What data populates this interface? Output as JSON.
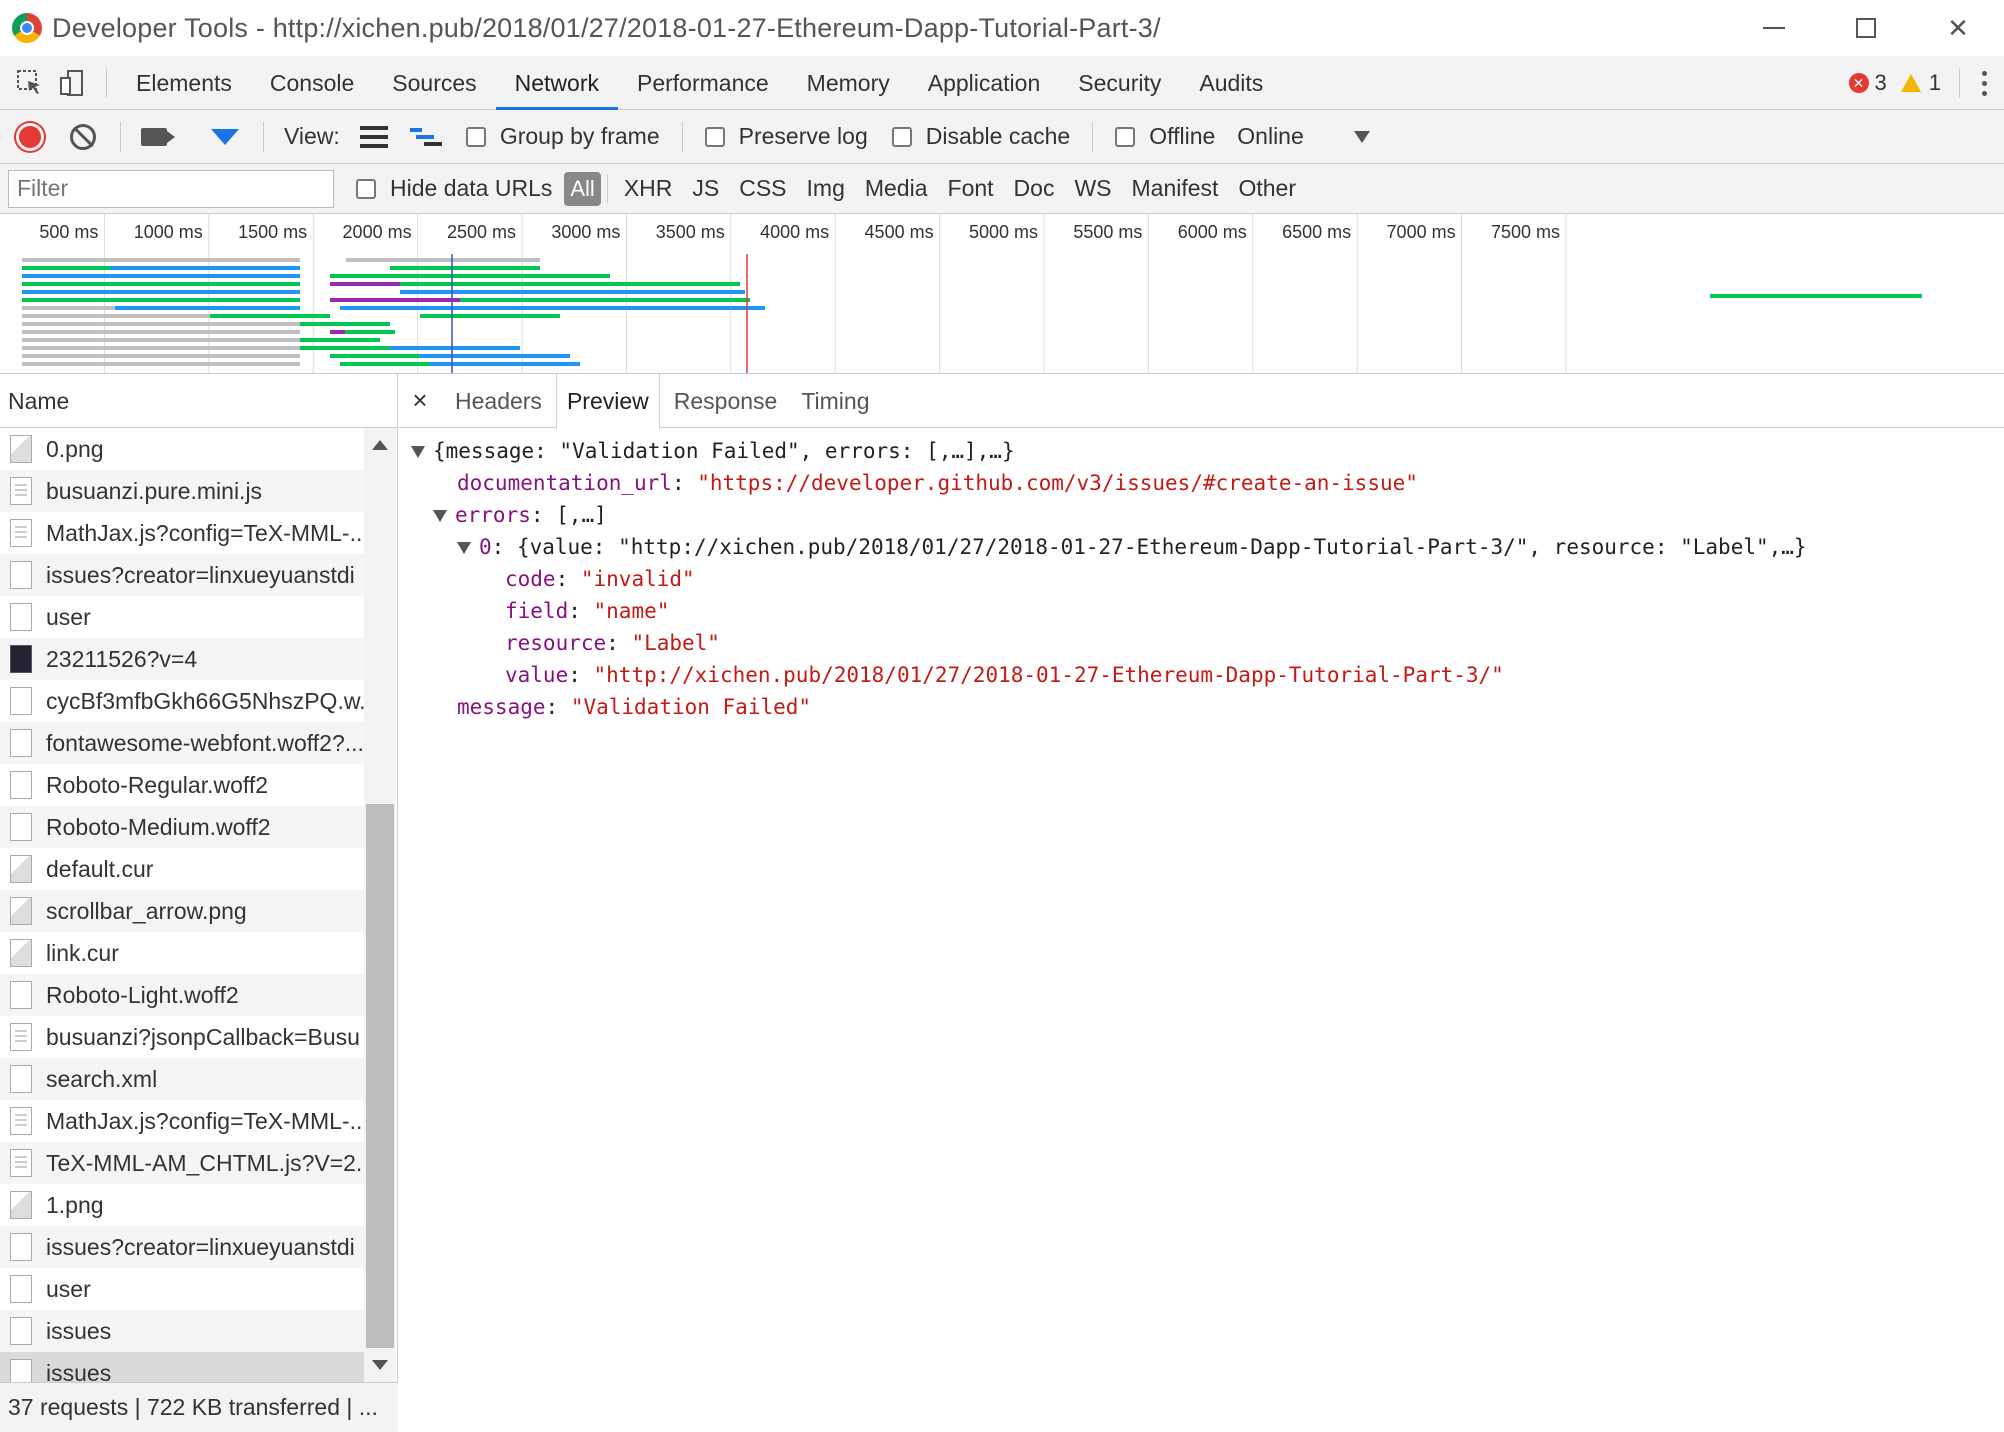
{
  "window": {
    "title": "Developer Tools - http://xichen.pub/2018/01/27/2018-01-27-Ethereum-Dapp-Tutorial-Part-3/",
    "close_glyph": "✕"
  },
  "main_tabs": [
    "Elements",
    "Console",
    "Sources",
    "Network",
    "Performance",
    "Memory",
    "Application",
    "Security",
    "Audits"
  ],
  "active_main_tab": "Network",
  "badges": {
    "errors": "3",
    "warnings": "1",
    "error_glyph": "✕"
  },
  "network_toolbar": {
    "view_label": "View:",
    "group_by_frame": "Group by frame",
    "preserve_log": "Preserve log",
    "disable_cache": "Disable cache",
    "offline": "Offline",
    "throttle": "Online"
  },
  "filter_bar": {
    "placeholder": "Filter",
    "hide_data_urls": "Hide data URLs",
    "types": [
      "All",
      "XHR",
      "JS",
      "CSS",
      "Img",
      "Media",
      "Font",
      "Doc",
      "WS",
      "Manifest",
      "Other"
    ]
  },
  "timeline": {
    "ticks": [
      "500 ms",
      "1000 ms",
      "1500 ms",
      "2000 ms",
      "2500 ms",
      "3000 ms",
      "3500 ms",
      "4000 ms",
      "4500 ms",
      "5000 ms",
      "5500 ms",
      "6000 ms",
      "6500 ms",
      "7000 ms",
      "7500 ms"
    ],
    "colors": {
      "waiting": "#00c853",
      "download": "#2196f3",
      "queued": "#c0c0c0",
      "ssl": "#9c27b0",
      "load_line": "#e53935",
      "dcl_line": "#3f51b5"
    }
  },
  "request_list": {
    "header": "Name",
    "items": [
      {
        "name": "0.png",
        "icon": "image-file-icon"
      },
      {
        "name": "busuanzi.pure.mini.js",
        "icon": "script-file-icon"
      },
      {
        "name": "MathJax.js?config=TeX-MML-...",
        "icon": "script-file-icon"
      },
      {
        "name": "issues?creator=linxueyuanstdi",
        "icon": "document-file-icon"
      },
      {
        "name": "user",
        "icon": "document-file-icon"
      },
      {
        "name": "23211526?v=4",
        "icon": "avatar-image-icon"
      },
      {
        "name": "cycBf3mfbGkh66G5NhszPQ.w...",
        "icon": "font-file-icon"
      },
      {
        "name": "fontawesome-webfont.woff2?...",
        "icon": "font-file-icon"
      },
      {
        "name": "Roboto-Regular.woff2",
        "icon": "font-file-icon"
      },
      {
        "name": "Roboto-Medium.woff2",
        "icon": "font-file-icon"
      },
      {
        "name": "default.cur",
        "icon": "cursor-file-icon"
      },
      {
        "name": "scrollbar_arrow.png",
        "icon": "image-file-icon"
      },
      {
        "name": "link.cur",
        "icon": "cursor-file-icon"
      },
      {
        "name": "Roboto-Light.woff2",
        "icon": "font-file-icon"
      },
      {
        "name": "busuanzi?jsonpCallback=Busu",
        "icon": "script-file-icon"
      },
      {
        "name": "search.xml",
        "icon": "document-file-icon"
      },
      {
        "name": "MathJax.js?config=TeX-MML-...",
        "icon": "script-file-icon"
      },
      {
        "name": "TeX-MML-AM_CHTML.js?V=2...",
        "icon": "script-file-icon"
      },
      {
        "name": "1.png",
        "icon": "image-file-icon"
      },
      {
        "name": "issues?creator=linxueyuanstdi",
        "icon": "document-file-icon"
      },
      {
        "name": "user",
        "icon": "document-file-icon"
      },
      {
        "name": "issues",
        "icon": "document-file-icon"
      },
      {
        "name": "issues",
        "icon": "document-file-icon"
      }
    ],
    "selected_index": 22,
    "status": "37 requests | 722 KB transferred | ..."
  },
  "detail_tabs": {
    "close": "×",
    "tabs": [
      "Headers",
      "Preview",
      "Response",
      "Timing"
    ],
    "active": "Preview"
  },
  "preview": {
    "root_summary": "{message: \"Validation Failed\", errors: [,…],…}",
    "documentation_url_key": "documentation_url",
    "documentation_url": "\"https://developer.github.com/v3/issues/#create-an-issue\"",
    "errors_key": "errors",
    "errors_summary": "[,…]",
    "error0_key": "0",
    "error0_summary": "{value: \"http://xichen.pub/2018/01/27/2018-01-27-Ethereum-Dapp-Tutorial-Part-3/\", resource: \"Label\",…}",
    "code_key": "code",
    "code_value": "\"invalid\"",
    "field_key": "field",
    "field_value": "\"name\"",
    "resource_key": "resource",
    "resource_value": "\"Label\"",
    "value_key": "value",
    "value_value": "\"http://xichen.pub/2018/01/27/2018-01-27-Ethereum-Dapp-Tutorial-Part-3/\"",
    "message_key": "message",
    "message_value": "\"Validation Failed\""
  }
}
